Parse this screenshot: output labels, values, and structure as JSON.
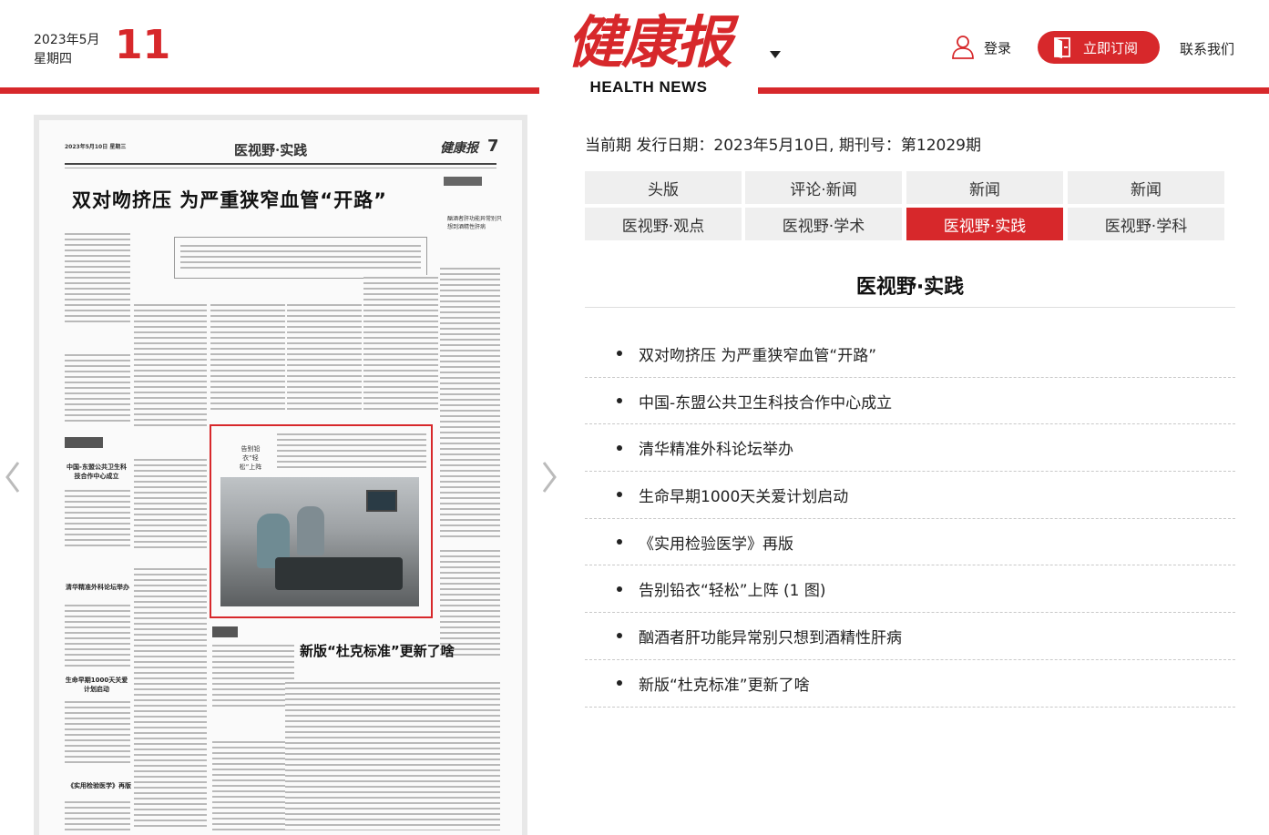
{
  "header": {
    "year_month": "2023年5月",
    "weekday": "星期四",
    "day": "11",
    "logo_cn": "健康报",
    "logo_en": "HEALTH NEWS",
    "login_label": "登录",
    "subscribe_label": "立即订阅",
    "contact_label": "联系我们"
  },
  "paper": {
    "head_date": "2023年5月10日 星期三",
    "section": "医视野·实践",
    "logo": "健康报",
    "page_no": "7",
    "main_title": "双对吻挤压 为严重狭窄血管“开路”",
    "highlight_text": "告别铅衣“轻松”上阵",
    "big_title": "新版“杜克标准”更新了啥",
    "left_heads": [
      "中国-东盟公共卫生科技合作中心成立",
      "清华精准外科论坛举办",
      "生命早期1000天关爱计划启动",
      "《实用检验医学》再版"
    ],
    "side_head": "酗酒者肝功能异常别只想到酒精性肝病"
  },
  "issue": {
    "text": "当前期 发行日期：2023年5月10日, 期刊号：第12029期"
  },
  "tabs": [
    {
      "label": "头版",
      "active": false
    },
    {
      "label": "评论·新闻",
      "active": false
    },
    {
      "label": "新闻",
      "active": false
    },
    {
      "label": "新闻",
      "active": false
    },
    {
      "label": "医视野·观点",
      "active": false
    },
    {
      "label": "医视野·学术",
      "active": false
    },
    {
      "label": "医视野·实践",
      "active": true
    },
    {
      "label": "医视野·学科",
      "active": false
    }
  ],
  "section_title": "医视野·实践",
  "articles": [
    "双对吻挤压 为严重狭窄血管“开路”",
    "中国-东盟公共卫生科技合作中心成立",
    "清华精准外科论坛举办",
    "生命早期1000天关爱计划启动",
    "《实用检验医学》再版",
    "告别铅衣“轻松”上阵 (1 图)",
    "酗酒者肝功能异常别只想到酒精性肝病",
    "新版“杜克标准”更新了啥"
  ],
  "icons": {
    "login": "user-icon",
    "subscribe": "door-icon",
    "prev": "chevron-left-icon",
    "next": "chevron-right-icon",
    "logo_menu": "caret-down-icon"
  },
  "colors": {
    "brand_red": "#d7282b",
    "tab_bg": "#efefef"
  }
}
